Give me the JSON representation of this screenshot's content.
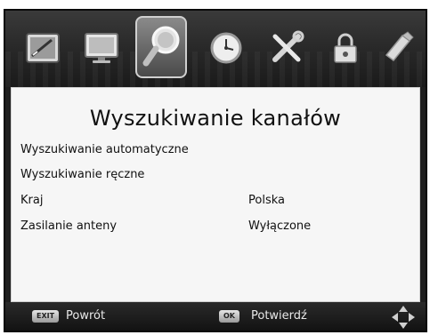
{
  "menu_bar": {
    "icons": [
      {
        "name": "picture-icon",
        "active": false
      },
      {
        "name": "tv-icon",
        "active": false
      },
      {
        "name": "search-icon",
        "active": true
      },
      {
        "name": "clock-icon",
        "active": false
      },
      {
        "name": "tools-icon",
        "active": false
      },
      {
        "name": "lock-icon",
        "active": false
      },
      {
        "name": "usb-icon",
        "active": false
      }
    ]
  },
  "panel": {
    "title": "Wyszukiwanie kanałów",
    "rows": [
      {
        "label": "Wyszukiwanie automatyczne",
        "value": ""
      },
      {
        "label": "Wyszukiwanie ręczne",
        "value": ""
      },
      {
        "label": "Kraj",
        "value": "Polska"
      },
      {
        "label": "Zasilanie anteny",
        "value": "Wyłączone"
      }
    ]
  },
  "footer": {
    "exit_key": "EXIT",
    "exit_label": "Powrót",
    "ok_key": "OK",
    "ok_label": "Potwierdź"
  },
  "colors": {
    "screen_bg": "#1e1e1e",
    "panel_bg": "#f6f6f6",
    "text": "#111111",
    "footer_text": "#e8e8e8"
  }
}
